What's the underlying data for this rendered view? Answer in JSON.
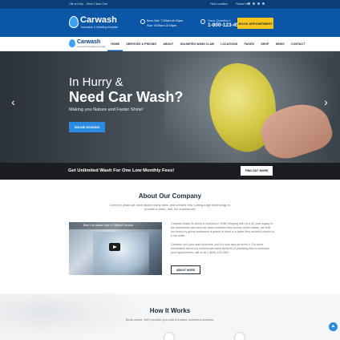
{
  "topbar": {
    "tagline": "Life is Dirty ...Drive Clean Car!",
    "find_location": "Find Location",
    "follow": "Follow Us"
  },
  "header": {
    "brand": "Carwash",
    "brand_sub": "Autowash & Detailing template",
    "hours_line1": "Mon-Sat: 7:00am-6:00pm",
    "hours_line2": "Sun: 8:00am-3:00pm",
    "question": "Have Question?",
    "phone": "1-800-123-4567",
    "book_button": "BOOK APPOINTMENT"
  },
  "nav": {
    "brand": "Carwash",
    "brand_sub": "Autowash & Detailing template",
    "items": [
      {
        "label": "HOME"
      },
      {
        "label": "SERVICES & PRICING"
      },
      {
        "label": "ABOUT"
      },
      {
        "label": "UNLIMITED WASH CLUB"
      },
      {
        "label": "LOCATIONS"
      },
      {
        "label": "PAGES"
      },
      {
        "label": "SHOP"
      },
      {
        "label": "NEWS"
      },
      {
        "label": "CONTACT"
      }
    ],
    "active_index": 0
  },
  "hero": {
    "line1": "In Hurry &",
    "line2": "Need Car Wash?",
    "tagline": "Making you Nature and Faster Shine!",
    "button": "ONLINE BOOKING",
    "prev_arrow": "‹",
    "next_arrow": "›"
  },
  "strip": {
    "text": "Get Unlimited Wash For One Low Monthly Fees!",
    "button": "FIND OUT MORE"
  },
  "about": {
    "title": "About Our Company",
    "intro": "Over the years we have added many sites, and created new cutting-edge technology to provide a clean, fast, fun experience!",
    "video_title": "Best Car Wash Fast & Efficient Service",
    "p1": "Carwash made its debut in America in 1998, bringing with us a 40 year legacy in the automotive care and car wash business from across seven states, we built our brand by giving customers a peace of mind to a place they wouldn't expect to, a car wash.",
    "p2": "Carwash isn't your start business, but it is ours and we know it. For more information about our commercial wash services of plumbing and to schedule your appointment, call us at 1 (800) 123-4567.",
    "button": "ABOUT MORE"
  },
  "how": {
    "title": "How It Works",
    "subtitle": "Book online. We'll provide you with a trusted, excellent services."
  },
  "colors": {
    "header_blue": "#0c56a8",
    "topbar_blue": "#0c3e77",
    "accent_yellow": "#f8c51c",
    "button_blue": "#2a8be0",
    "strip_dark": "#1b1d20"
  },
  "icons": {
    "scroll_top": "▲"
  }
}
